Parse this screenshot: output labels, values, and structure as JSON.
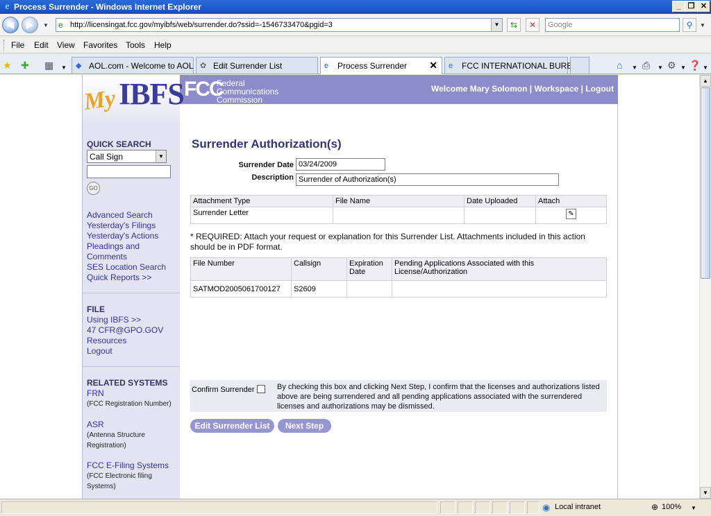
{
  "window": {
    "title": "Process Surrender - Windows Internet Explorer"
  },
  "address": {
    "url": "http://licensingat.fcc.gov/myibfs/web/surrender.do?ssid=-1546733470&pgid=3",
    "search_placeholder": "Google"
  },
  "menu": {
    "items": [
      "File",
      "Edit",
      "View",
      "Favorites",
      "Tools",
      "Help"
    ]
  },
  "tabs": [
    {
      "label": "AOL.com - Welcome to AOL"
    },
    {
      "label": "Edit Surrender List"
    },
    {
      "label": "Process Surrender"
    },
    {
      "label": "FCC INTERNATIONAL BUREAU"
    }
  ],
  "header": {
    "logo_my": "My",
    "logo_ibfs": "IBFS",
    "fcc_mark": "FCC",
    "fcc_lines": [
      "Federal",
      "Communications",
      "Commission"
    ],
    "welcome": "Welcome Mary Solomon",
    "workspace": "Workspace",
    "logout": "Logout",
    "sep": "|"
  },
  "sidebar": {
    "quick_search": "QUICK SEARCH",
    "select_value": "Call Sign",
    "go": "GO",
    "links1": [
      "Advanced Search",
      "Yesterday's Filings",
      "Yesterday's Actions",
      "Pleadings and",
      "Comments",
      "SES Location Search",
      "Quick Reports >>"
    ],
    "file_head": "FILE",
    "links2": [
      "Using IBFS >>",
      "47 CFR@GPO.GOV",
      "Resources",
      "Logout"
    ],
    "related_head": "RELATED SYSTEMS",
    "frn": "FRN",
    "frn_note": "(FCC Registration Number)",
    "asr": "ASR",
    "asr_note1": "(Antenna Structure",
    "asr_note2": "Registration)",
    "efiling": "FCC E-Filing Systems",
    "efiling_note1": "(FCC Electronic filing",
    "efiling_note2": "Systems)"
  },
  "main": {
    "title": "Surrender Authorization(s)",
    "surrender_date_label": "Surrender Date",
    "surrender_date": "03/24/2009",
    "description_label": "Description",
    "description": "Surrender of Authorization(s)",
    "attach_headers": [
      "Attachment Type",
      "File Name",
      "Date Uploaded",
      "Attach"
    ],
    "attach_row": [
      "Surrender Letter",
      "",
      ""
    ],
    "note": "* REQUIRED: Attach your request or explanation for this Surrender List. Attachments included in this action should be in PDF format.",
    "list_headers": [
      "File Number",
      "Callsign",
      "Expiration Date",
      "Pending Applications Associated with this License/Authorization"
    ],
    "list_row": [
      "SATMOD2005061700127",
      "S2609",
      "",
      ""
    ],
    "confirm_label": "Confirm Surrender",
    "confirm_text": "By checking this box and clicking Next Step, I confirm that the licenses and authorizations listed above are being surrendered and all pending applications associated with the surrendered licenses and authorizations may be dismissed.",
    "edit_button": "Edit Surrender List",
    "next_button": "Next Step"
  },
  "status": {
    "zone": "Local intranet",
    "zoom": "100%"
  }
}
